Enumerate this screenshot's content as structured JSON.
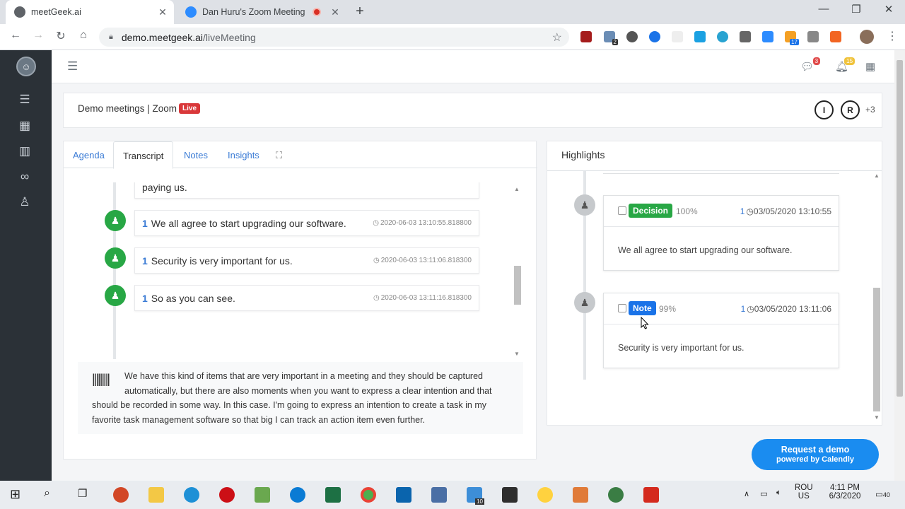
{
  "browser": {
    "tabs": [
      {
        "title": "meetGeek.ai"
      },
      {
        "title": "Dan Huru's Zoom Meeting"
      }
    ],
    "close_glyph": "✕",
    "new_tab_glyph": "+",
    "window_controls": [
      "—",
      "❐",
      "✕"
    ],
    "url_host": "demo.meetgeek.ai",
    "url_path": "/liveMeeting",
    "extension_badges": {
      "ext2": "2",
      "ext9": "17"
    }
  },
  "app": {
    "colors": {
      "sidebar": "#2b3137",
      "accent": "#3a7bd5",
      "live": "#d9383a",
      "speaker": "#28a745",
      "decision": "#28a745",
      "note": "#1a73e8",
      "demo_button": "#1a8cf0"
    },
    "top_icons": {
      "messages_count": "3",
      "notifications_count": "15"
    },
    "header": {
      "meeting_title": "Demo meetings | Zoom",
      "live_label": "Live",
      "participants": [
        "I",
        "R"
      ],
      "more_participants": "+3"
    },
    "tabs": [
      {
        "label": "Agenda"
      },
      {
        "label": "Transcript"
      },
      {
        "label": "Notes"
      },
      {
        "label": "Insights"
      }
    ],
    "transcript": {
      "partial_text": "paying us.",
      "items": [
        {
          "speaker": "1",
          "text": "We all agree to start upgrading our software.",
          "timestamp": "2020-06-03 13:10:55.818800"
        },
        {
          "speaker": "1",
          "text": "Security is very important for us.",
          "timestamp": "2020-06-03 13:11:06.818300"
        },
        {
          "speaker": "1",
          "text": "So as you can see.",
          "timestamp": "2020-06-03 13:11:16.818300"
        }
      ],
      "live_text": "We have this kind of items that are very important in a meeting and they should be captured automatically, but there are also moments when you want to express a clear intention and that should be recorded in some way. In this case. I'm going to express an intention to create a task in my favorite task management software so that big I can track an action item even further."
    },
    "highlights": {
      "title": "Highlights",
      "cards": [
        {
          "type": "Decision",
          "confidence": "100%",
          "speaker": "1",
          "timestamp": "03/05/2020 13:10:55",
          "text": "We all agree to start upgrading our software."
        },
        {
          "type": "Note",
          "confidence": "99%",
          "speaker": "1",
          "timestamp": "03/05/2020 13:11:06",
          "text": "Security is very important for us."
        }
      ]
    },
    "demo_button": {
      "line1": "Request a demo",
      "line2": "powered by Calendly"
    }
  },
  "taskbar": {
    "language": "ROU",
    "layout": "US",
    "time": "4:11 PM",
    "date": "6/3/2020",
    "notifications": "40",
    "badge_ie": "10"
  }
}
